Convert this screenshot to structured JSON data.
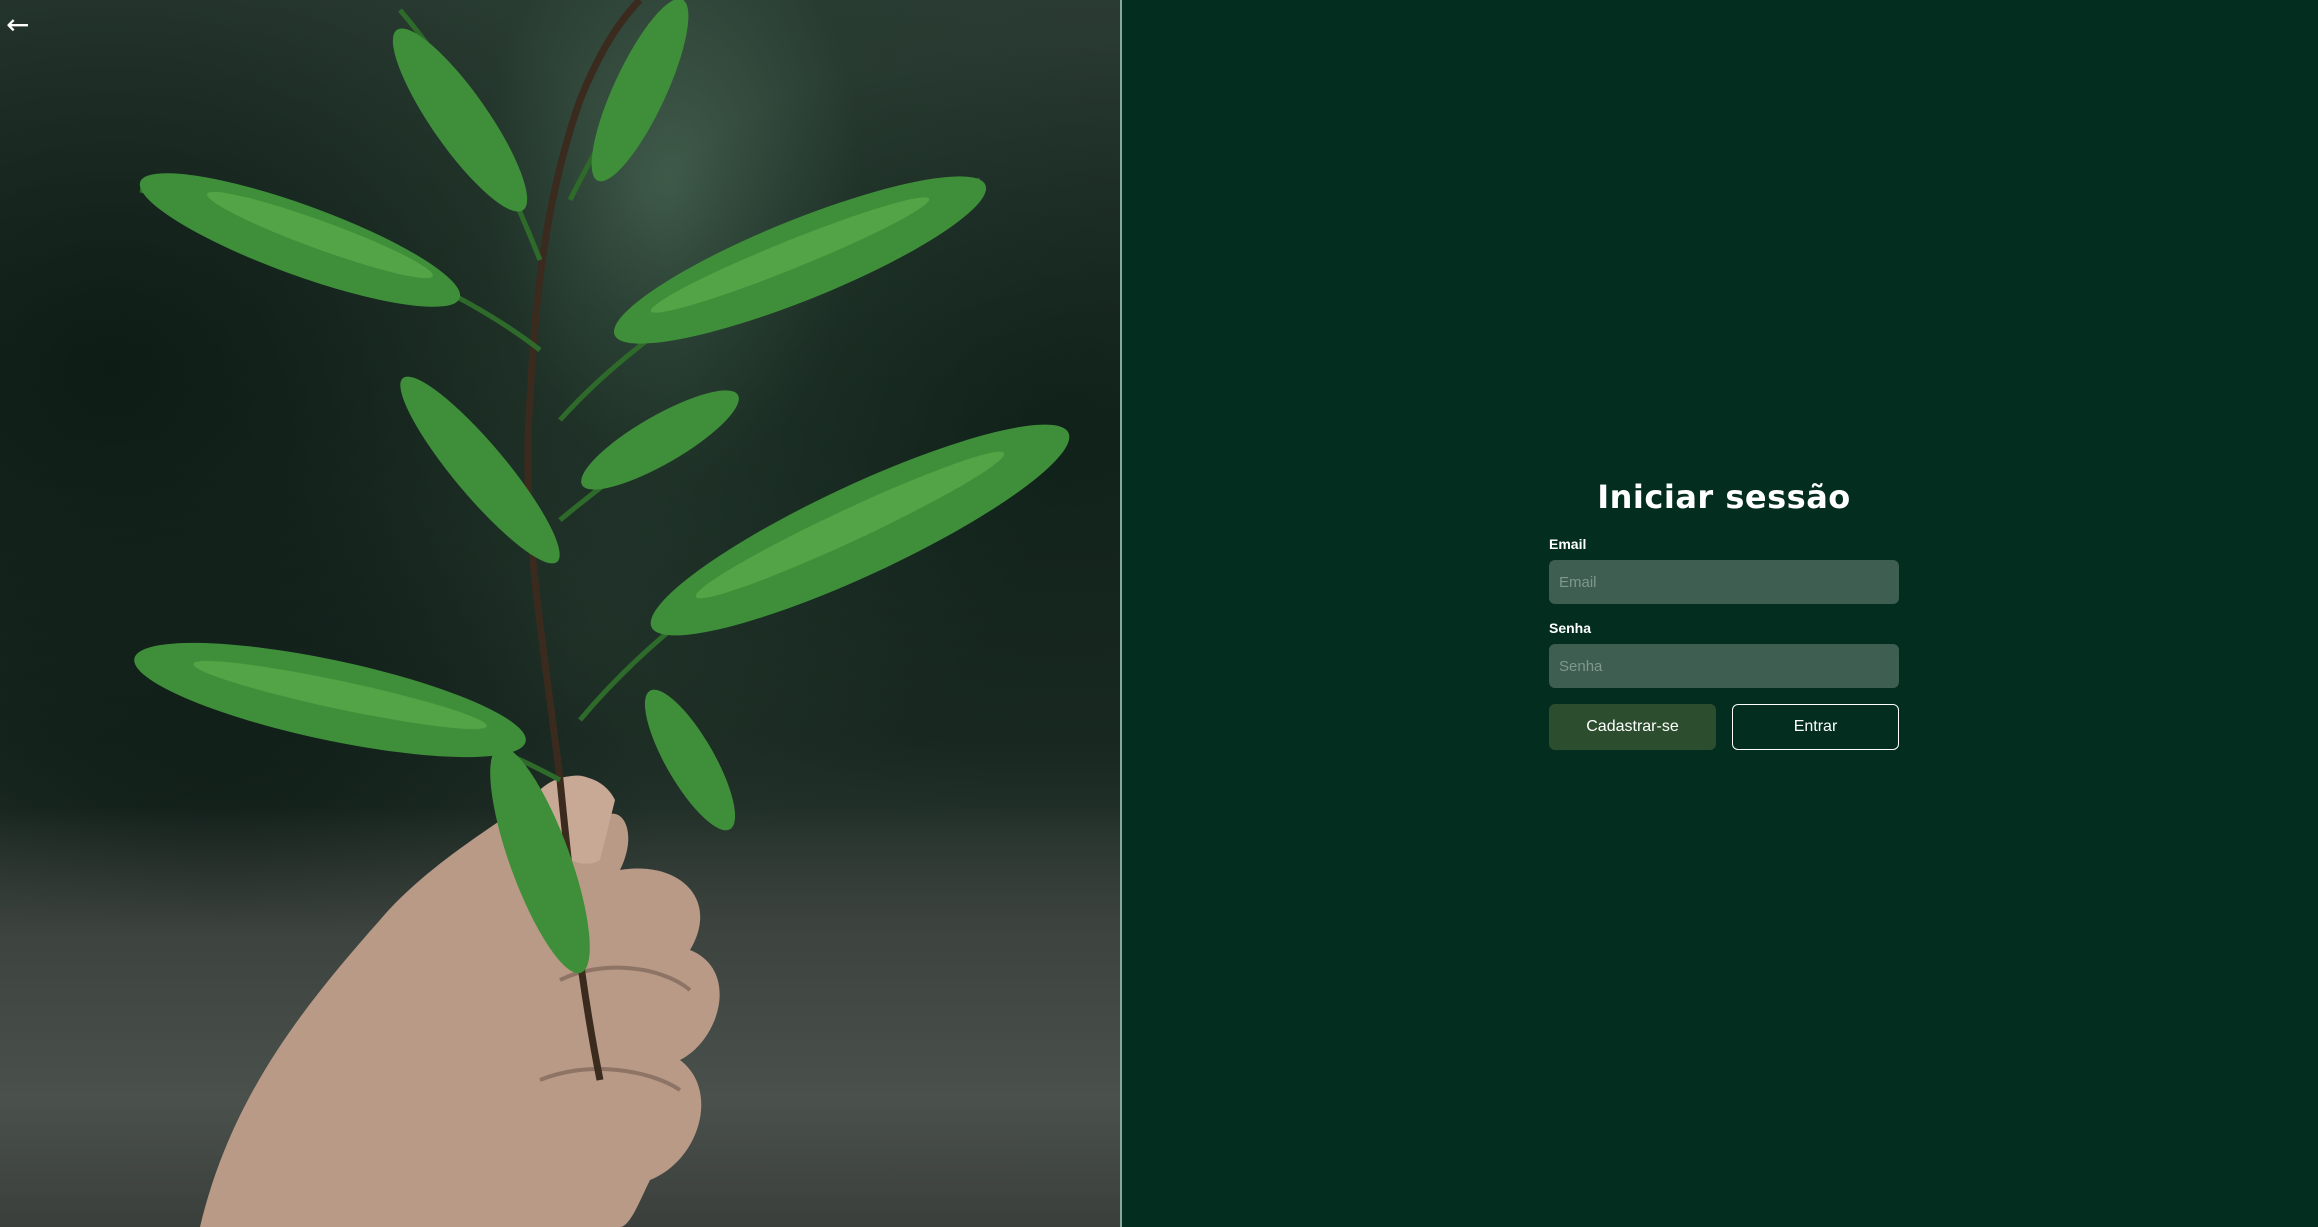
{
  "nav": {
    "back_icon": "arrow-left-icon",
    "back_glyph": "←"
  },
  "login": {
    "title": "Iniciar sessão",
    "email_label": "Email",
    "email_placeholder": "Email",
    "email_value": "",
    "password_label": "Senha",
    "password_placeholder": "Senha",
    "password_value": "",
    "register_label": "Cadastrar-se",
    "submit_label": "Entrar"
  },
  "colors": {
    "background": "#022d1f",
    "input_background": "#3e5e52",
    "register_button": "#2c4e2f",
    "text": "#ffffff"
  }
}
